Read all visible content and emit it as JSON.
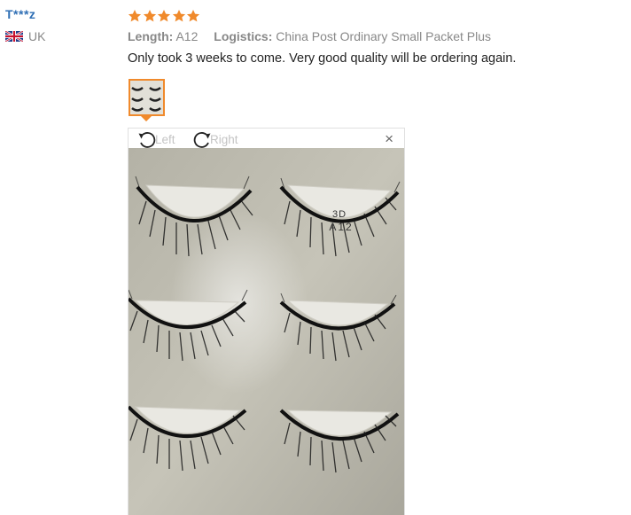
{
  "reviewer": {
    "name": "T***z",
    "country": "UK",
    "flag_icon": "uk-flag-icon"
  },
  "review": {
    "rating": 5,
    "star_color": "#f08a2c",
    "length_label": "Length:",
    "length_value": "A12",
    "logistics_label": "Logistics:",
    "logistics_value": "China Post Ordinary Small Packet Plus",
    "comment": "Only took 3 weeks to come. Very good quality will be ordering again."
  },
  "viewer": {
    "rotate_left_label": "Left",
    "rotate_right_label": "Right",
    "close_symbol": "×",
    "photo_text_line1": "3D",
    "photo_text_line2": "A12"
  }
}
